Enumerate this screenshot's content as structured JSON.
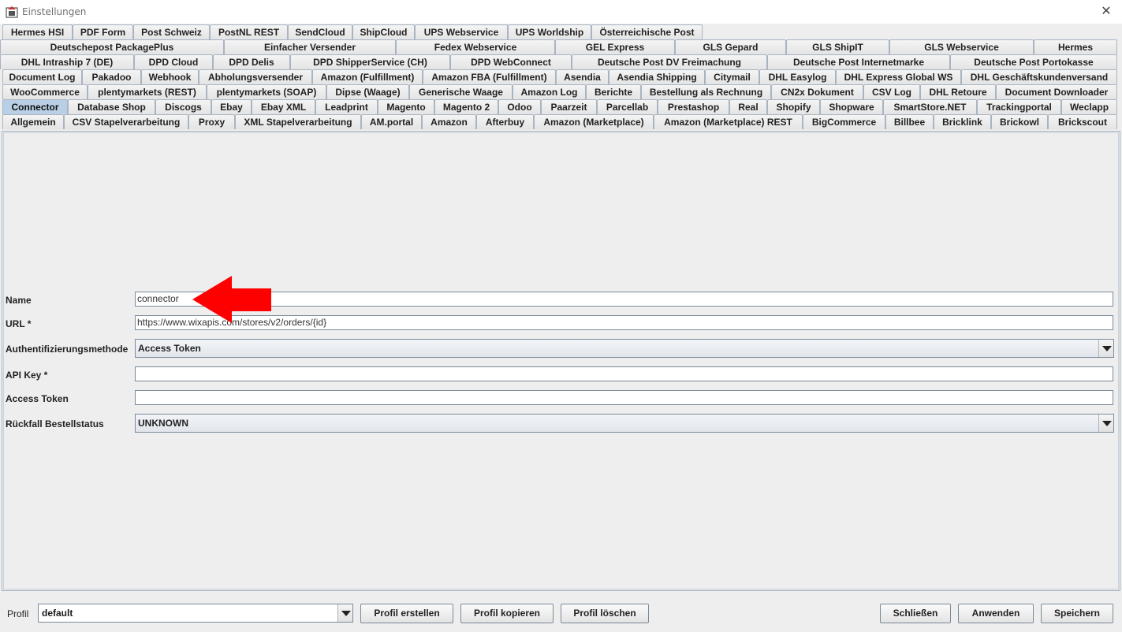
{
  "window": {
    "title": "Einstellungen",
    "close_label": "✕"
  },
  "tab_rows": [
    [
      "Hermes HSI",
      "PDF Form",
      "Post Schweiz",
      "PostNL REST",
      "SendCloud",
      "ShipCloud",
      "UPS Webservice",
      "UPS Worldship",
      "Österreichische Post"
    ],
    [
      "Deutschepost PackagePlus",
      "Einfacher Versender",
      "Fedex Webservice",
      "GEL Express",
      "GLS Gepard",
      "GLS ShipIT",
      "GLS Webservice",
      "Hermes"
    ],
    [
      "DHL Intraship 7 (DE)",
      "DPD Cloud",
      "DPD Delis",
      "DPD ShipperService (CH)",
      "DPD WebConnect",
      "Deutsche Post DV Freimachung",
      "Deutsche Post Internetmarke",
      "Deutsche Post Portokasse"
    ],
    [
      "Document Log",
      "Pakadoo",
      "Webhook",
      "Abholungsversender",
      "Amazon (Fulfillment)",
      "Amazon FBA (Fulfillment)",
      "Asendia",
      "Asendia Shipping",
      "Citymail",
      "DHL Easylog",
      "DHL Express Global WS",
      "DHL Geschäftskundenversand"
    ],
    [
      "WooCommerce",
      "plentymarkets (REST)",
      "plentymarkets (SOAP)",
      "Dipse (Waage)",
      "Generische Waage",
      "Amazon Log",
      "Berichte",
      "Bestellung als Rechnung",
      "CN2x Dokument",
      "CSV Log",
      "DHL Retoure",
      "Document Downloader"
    ],
    [
      "Connector",
      "Database Shop",
      "Discogs",
      "Ebay",
      "Ebay XML",
      "Leadprint",
      "Magento",
      "Magento 2",
      "Odoo",
      "Paarzeit",
      "Parcellab",
      "Prestashop",
      "Real",
      "Shopify",
      "Shopware",
      "SmartStore.NET",
      "Trackingportal",
      "Weclapp"
    ],
    [
      "Allgemein",
      "CSV Stapelverarbeitung",
      "Proxy",
      "XML Stapelverarbeitung",
      "AM.portal",
      "Amazon",
      "Afterbuy",
      "Amazon (Marketplace)",
      "Amazon (Marketplace) REST",
      "BigCommerce",
      "Billbee",
      "Bricklink",
      "Brickowl",
      "Brickscout"
    ]
  ],
  "selected_tab": "Connector",
  "form": {
    "name_label": "Name",
    "name_value": "connector",
    "url_label": "URL *",
    "url_value": "https://www.wixapis.com/stores/v2/orders/{id}",
    "auth_label": "Authentifizierungsmethode",
    "auth_value": "Access Token",
    "apikey_label": "API Key *",
    "apikey_value": "",
    "token_label": "Access Token",
    "token_value": "",
    "fallback_label": "Rückfall Bestellstatus",
    "fallback_value": "UNKNOWN"
  },
  "bottom": {
    "profil_label": "Profil",
    "profil_value": "default",
    "create_label": "Profil erstellen",
    "copy_label": "Profil kopieren",
    "delete_label": "Profil löschen",
    "close_label": "Schließen",
    "apply_label": "Anwenden",
    "save_label": "Speichern"
  },
  "colors": {
    "selected_tab": "#b8cfe5",
    "annotation_arrow": "#ff0000",
    "background": "#eeeeee"
  }
}
